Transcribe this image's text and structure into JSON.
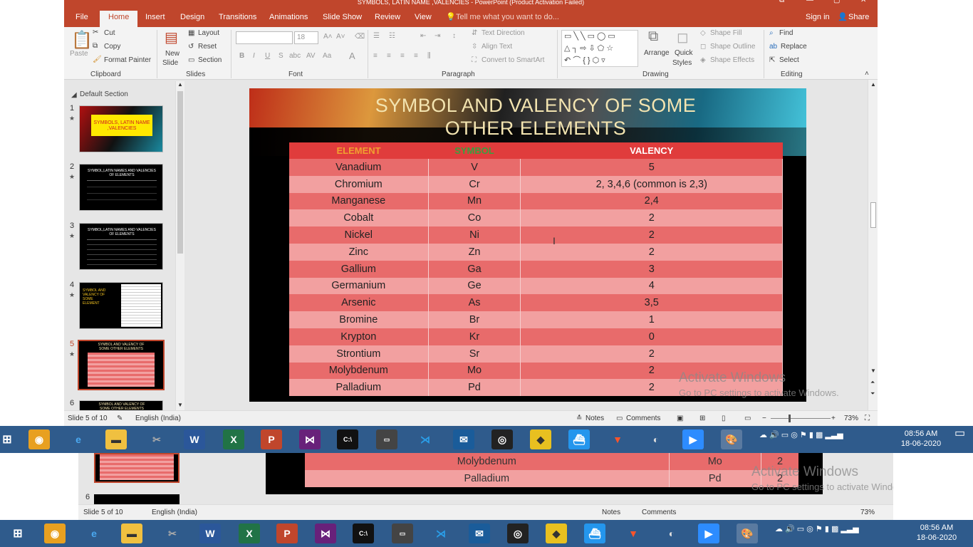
{
  "window": {
    "title": "SYMBOLS, LATIN NAME ,VALENCIES - PowerPoint (Product Activation Failed)",
    "controls": [
      "⧉",
      "—",
      "▢",
      "✕"
    ]
  },
  "ribbon": {
    "tabs": [
      "File",
      "Home",
      "Insert",
      "Design",
      "Transitions",
      "Animations",
      "Slide Show",
      "Review",
      "View"
    ],
    "active_tab": "Home",
    "tell_me": "Tell me what you want to do...",
    "sign_in": "Sign in",
    "share": "Share",
    "clipboard": {
      "paste": "Paste",
      "cut": "Cut",
      "copy": "Copy",
      "format_painter": "Format Painter",
      "label": "Clipboard"
    },
    "slides": {
      "new_slide": "New",
      "new_slide2": "Slide",
      "layout": "Layout",
      "reset": "Reset",
      "section": "Section",
      "label": "Slides"
    },
    "font": {
      "name": "",
      "size": "18",
      "label": "Font"
    },
    "paragraph": {
      "text_direction": "Text Direction",
      "align_text": "Align Text",
      "smartart": "Convert to SmartArt",
      "label": "Paragraph"
    },
    "drawing": {
      "arrange": "Arrange",
      "quick_styles": "Quick",
      "quick_styles2": "Styles",
      "shape_fill": "Shape Fill",
      "shape_outline": "Shape Outline",
      "shape_effects": "Shape Effects",
      "label": "Drawing"
    },
    "editing": {
      "find": "Find",
      "replace": "Replace",
      "select": "Select",
      "label": "Editing"
    }
  },
  "thumbnails": {
    "section": "Default Section",
    "items": [
      {
        "num": "1",
        "title": "SYMBOLS, LATIN NAME ,VALENCIES"
      },
      {
        "num": "2",
        "title": "SYMBOL,LATIN NAMES AND VALENCIES OF ELEMENTS"
      },
      {
        "num": "3",
        "title": "SYMBOL,LATIN NAMES AND VALENCIES OF ELEMENTS"
      },
      {
        "num": "4",
        "title": "SYMBOL AND VALENCY OF SOME ELEMENT"
      },
      {
        "num": "5",
        "title": "SYMBOL AND VALENCY OF SOME OTHER ELEMENTS"
      },
      {
        "num": "6",
        "title": "SYMBOL AND VALENCY OF SOME OTHER ELEMENTS"
      }
    ]
  },
  "slide": {
    "title_line1": "SYMBOL AND VALENCY OF SOME",
    "title_line2": "OTHER ELEMENTS",
    "headers": [
      "ELEMENT",
      "SYMBOL",
      "VALENCY"
    ],
    "header_colors": [
      "#f0a030",
      "#3aa040",
      "#ffffff"
    ],
    "rows": [
      [
        "Vanadium",
        "V",
        "5"
      ],
      [
        "Chromium",
        "Cr",
        "2, 3,4,6  (common is 2,3)"
      ],
      [
        "Manganese",
        "Mn",
        "2,4"
      ],
      [
        "Cobalt",
        "Co",
        "2"
      ],
      [
        "Nickel",
        "Ni",
        "2"
      ],
      [
        "Zinc",
        "Zn",
        "2"
      ],
      [
        "Gallium",
        "Ga",
        "3"
      ],
      [
        "Germanium",
        "Ge",
        "4"
      ],
      [
        "Arsenic",
        "As",
        "3,5"
      ],
      [
        "Bromine",
        "Br",
        "1"
      ],
      [
        "Krypton",
        "Kr",
        "0"
      ],
      [
        "Strontium",
        "Sr",
        "2"
      ],
      [
        "Molybdenum",
        "Mo",
        "2"
      ],
      [
        "Palladium",
        "Pd",
        "2"
      ]
    ]
  },
  "watermark": {
    "line1": "Activate Windows",
    "line2": "Go to PC settings to activate Windows."
  },
  "status": {
    "slide": "Slide 5 of 10",
    "language": "English (India)",
    "notes": "Notes",
    "comments": "Comments",
    "zoom": "73%"
  },
  "taskbar": {
    "apps": [
      "Chrome",
      "Internet Explorer",
      "File Explorer",
      "Snipping",
      "Word",
      "Excel",
      "PowerPoint",
      "Visual Studio",
      "Command Prompt",
      "Command Prompt",
      "VS Code",
      "Thunderbird",
      "OBS",
      "Maps",
      "Docker",
      "Brave",
      "Remote",
      "Zoom",
      "Paint"
    ],
    "time": "08:56 AM",
    "date": "18-06-2020"
  },
  "lower_echo": {
    "rows": [
      [
        "Molybdenum",
        "Mo",
        "2"
      ],
      [
        "Palladium",
        "Pd",
        "2"
      ]
    ],
    "thumb_num": "6",
    "time": "08:56 AM",
    "date": "18-06-2020"
  }
}
